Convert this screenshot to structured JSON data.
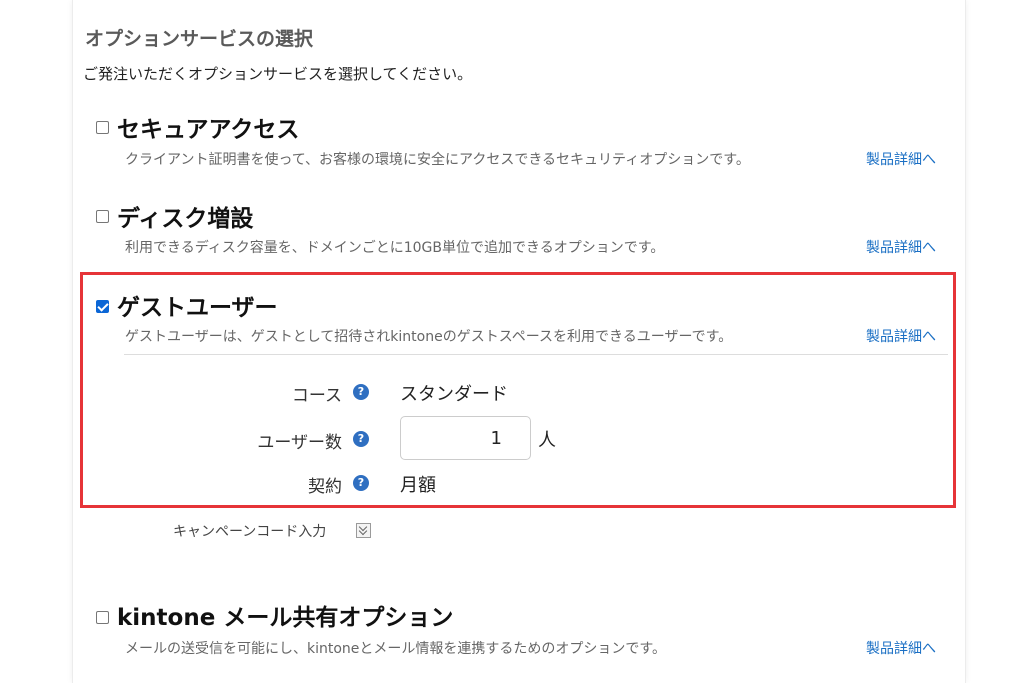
{
  "section": {
    "title": "オプションサービスの選択",
    "description": "ご発注いただくオプションサービスを選択してください。"
  },
  "options": [
    {
      "title": "セキュアアクセス",
      "description": "クライアント証明書を使って、お客様の環境に安全にアクセスできるセキュリティオプションです。",
      "detail_link": "製品詳細へ",
      "checked": false
    },
    {
      "title": "ディスク増設",
      "description": "利用できるディスク容量を、ドメインごとに10GB単位で追加できるオプションです。",
      "detail_link": "製品詳細へ",
      "checked": false
    },
    {
      "title": "ゲストユーザー",
      "description": "ゲストユーザーは、ゲストとして招待されkintoneのゲストスペースを利用できるユーザーです。",
      "detail_link": "製品詳細へ",
      "checked": true
    },
    {
      "title": "kintone メール共有オプション",
      "description": "メールの送受信を可能にし、kintoneとメール情報を連携するためのオプションです。",
      "detail_link": "製品詳細へ",
      "checked": false
    }
  ],
  "guest_fields": {
    "course_label": "コース",
    "course_value": "スタンダード",
    "users_label": "ユーザー数",
    "users_value": "1",
    "users_unit": "人",
    "contract_label": "契約",
    "contract_value": "月額",
    "help_icon": "question-circle-icon"
  },
  "campaign": {
    "label": "キャンペーンコード入力",
    "icon": "double-chevron-down-icon"
  },
  "colors": {
    "link": "#1a6fc4",
    "highlight_border": "#e63438",
    "checkbox_checked": "#0b66d6",
    "help_icon": "#2f6fc1"
  }
}
